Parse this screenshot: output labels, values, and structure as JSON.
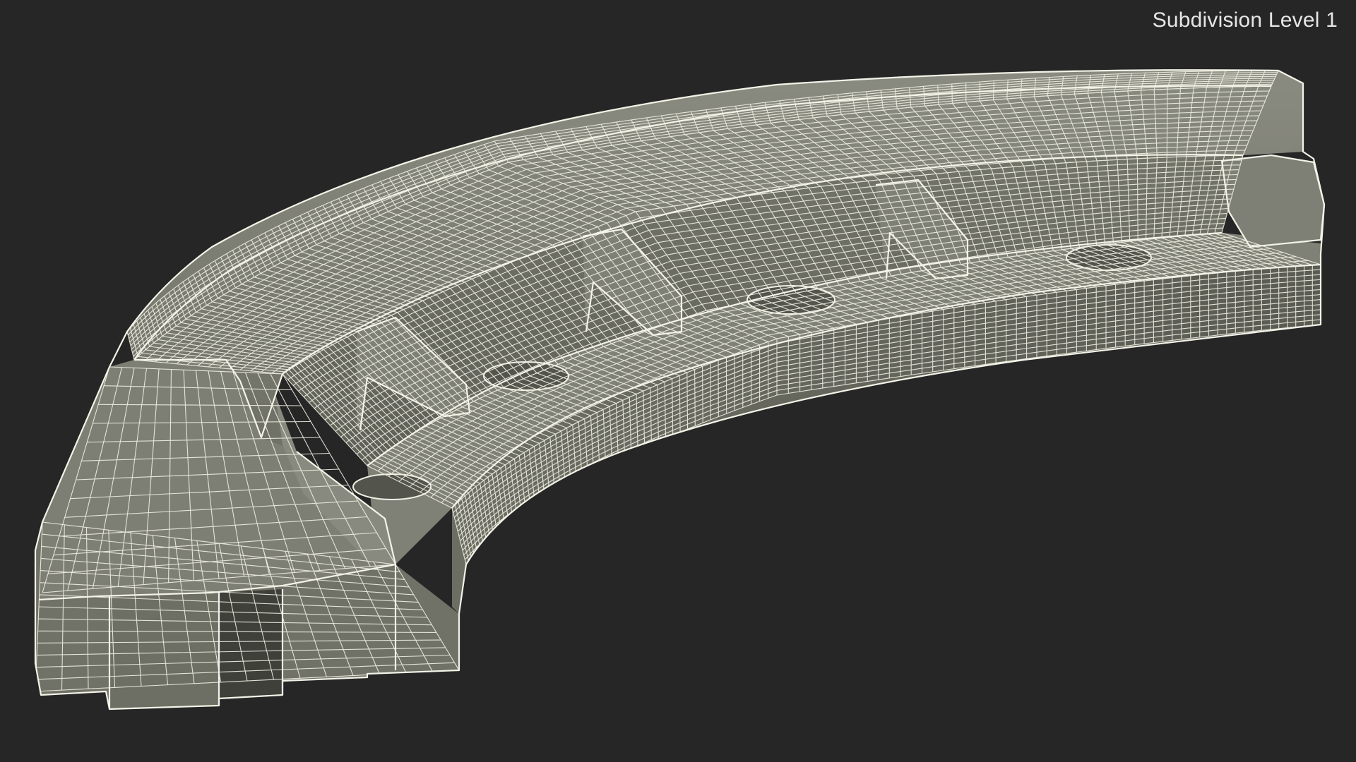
{
  "viewport": {
    "label": "Subdivision Level 1"
  },
  "colors": {
    "background": "#262626",
    "surface": "#7c7d72",
    "surface_dark": "#55564e",
    "wire": "#f1f0e4"
  },
  "model": {
    "subject": "curved bracket 3D model wireframe"
  }
}
